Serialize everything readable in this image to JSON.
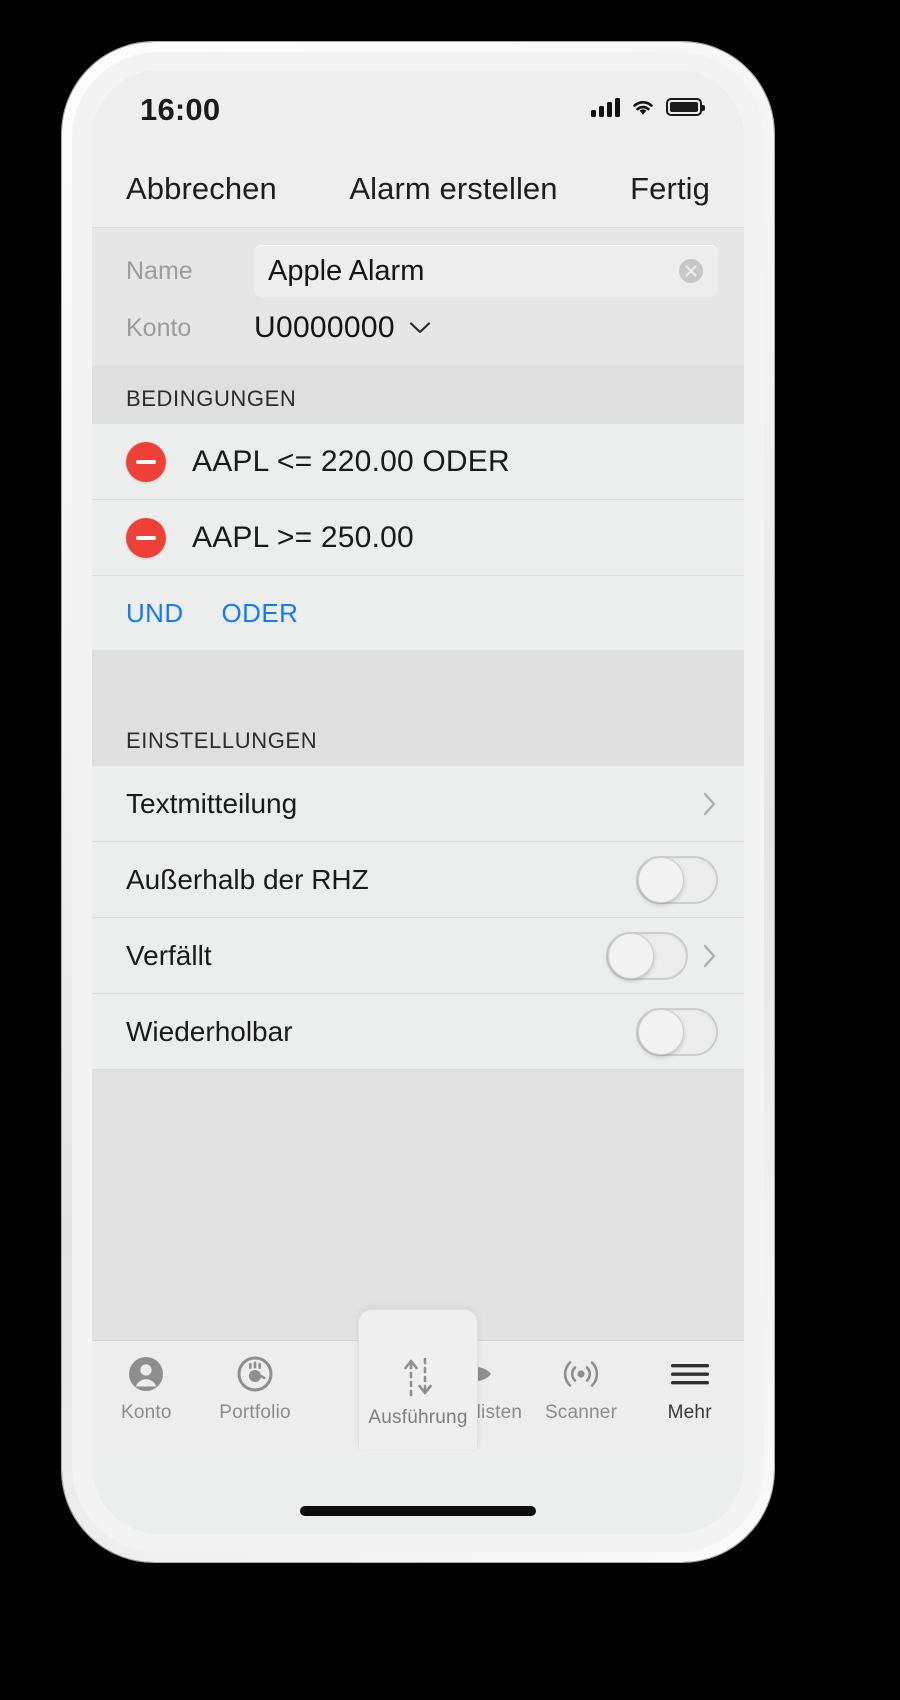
{
  "status_bar": {
    "time": "16:00",
    "signal_icon": "cellular-signal-icon",
    "wifi_icon": "wifi-icon",
    "battery_icon": "battery-full-icon"
  },
  "nav_bar": {
    "cancel_label": "Abbrechen",
    "title": "Alarm erstellen",
    "done_label": "Fertig"
  },
  "form": {
    "name_label": "Name",
    "name_value": "Apple Alarm",
    "name_placeholder": "Name",
    "clear_icon": "clear-circle-icon",
    "account_label": "Konto",
    "account_value": "U0000000",
    "account_chevron_icon": "chevron-down-icon"
  },
  "conditions": {
    "header": "BEDINGUNGEN",
    "items": [
      {
        "remove_icon": "minus-circle-icon",
        "text": "AAPL <= 220.00 ODER"
      },
      {
        "remove_icon": "minus-circle-icon",
        "text": "AAPL >= 250.00"
      }
    ],
    "logic_buttons": [
      {
        "label": "UND"
      },
      {
        "label": "ODER"
      }
    ],
    "accent_color": "#1578ff",
    "remove_color": "#ef4037"
  },
  "settings": {
    "header": "EINSTELLUNGEN",
    "rows": [
      {
        "label": "Textmitteilung",
        "control": "chevron",
        "chevron_icon": "chevron-right-icon",
        "toggle_on": false
      },
      {
        "label": "Außerhalb der RHZ",
        "control": "toggle",
        "toggle_on": false
      },
      {
        "label": "Verfällt",
        "control": "toggle-chevron",
        "chevron_icon": "chevron-right-icon",
        "toggle_on": false
      },
      {
        "label": "Wiederholbar",
        "control": "toggle",
        "toggle_on": false
      }
    ]
  },
  "tab_bar": {
    "tabs": [
      {
        "label": "Konto",
        "icon": "account-person-icon",
        "active": false
      },
      {
        "label": "Portfolio",
        "icon": "portfolio-pie-icon",
        "active": false
      },
      {
        "label": "Ausführung",
        "icon": "order-arrows-icon",
        "active": true
      },
      {
        "label": "Watchlisten",
        "icon": "eye-icon",
        "active": false
      },
      {
        "label": "Scanner",
        "icon": "scanner-waves-icon",
        "active": false
      },
      {
        "label": "Mehr",
        "icon": "hamburger-menu-icon",
        "active": false
      }
    ]
  }
}
